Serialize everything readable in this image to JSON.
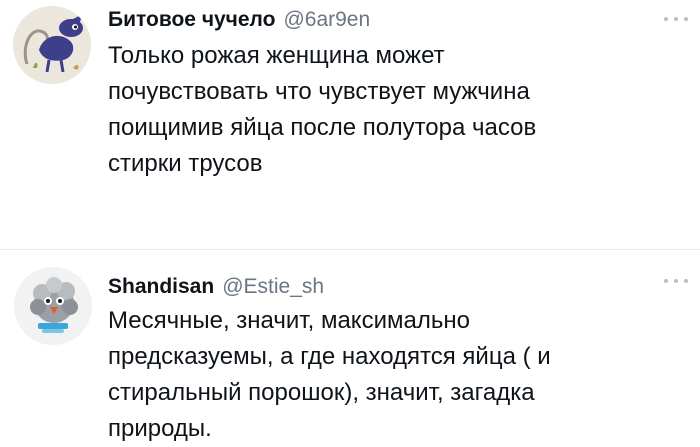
{
  "tweets": [
    {
      "display_name": "Битовое чучело",
      "handle": "@6ar9en",
      "avatar_icon": "cartoon-character-avatar",
      "text_lines": [
        "Только рожая женщина может",
        "почувствовать что чувствует мужчина",
        "поищимив яйца после полутора часов",
        "стирки трусов"
      ],
      "more_icon": "more-options-icon"
    },
    {
      "display_name": "Shandisan",
      "handle": "@Estie_sh",
      "avatar_icon": "fluffy-bird-avatar",
      "text_lines": [
        "Месячные, значит, максимально",
        "предсказуемы, а где находятся яйца ( и",
        "стиральный порошок), значит, загадка",
        "природы."
      ],
      "more_icon": "more-options-icon"
    }
  ],
  "colors": {
    "text": "#0f1419",
    "handle": "#6b7682",
    "divider": "#eceff1",
    "dots": "#b8bfc6"
  }
}
